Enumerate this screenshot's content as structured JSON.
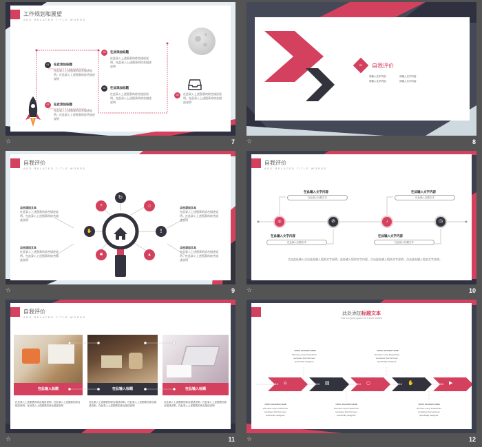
{
  "common": {
    "star": "☆",
    "sub": "ADD RELATED TITLE WORDS",
    "heading": "自我评价"
  },
  "s7": {
    "num": "7",
    "title": "工作规划和展望",
    "items": [
      {
        "no": "01",
        "head": "在此添加标题",
        "body": "在此录入上述图表的综合描述说明，在此录入上述图表的综合描述说明"
      },
      {
        "no": "02",
        "head": "在此添加标题",
        "body": "在此录入上述图表的综合描述说明，在此录入上述图表的综合描述说明"
      },
      {
        "no": "03",
        "head": "在此添加标题",
        "body": "在此录入上述图表的综合描述说明，在此录入上述图表的综合描述说明"
      },
      {
        "no": "04",
        "head": "在此添加标题",
        "body": "在此录入上述图表的综合描述说明，在此录入上述图表的综合描述说明"
      },
      {
        "no": "05",
        "body": "在此录入上述图表的综合描述说明，在此录入上述图表的综合描述说明"
      }
    ]
  },
  "s8": {
    "num": "8",
    "no": "02",
    "title": "自我评价",
    "lines": [
      "请输入文字内容",
      "请输入文字内容",
      "请输入文字内容",
      "请输入文字内容"
    ]
  },
  "s9": {
    "num": "9",
    "labels": [
      {
        "head": "点击添加文本",
        "body": "在此录入上述图表的综合描述说明，在此录入上述图表的综合描述说明"
      },
      {
        "head": "点击添加文本",
        "body": "在此录入上述图表的综合描述说明，在此录入上述图表的综合描述说明"
      },
      {
        "head": "点击添加文本",
        "body": "在此录入上述图表的综合描述说明，在此录入上述图表的综合描述说明"
      },
      {
        "head": "点击添加文本",
        "body": "在此录入上述图表的综合描述说明，在此录入上述图表的综合描述说明"
      }
    ]
  },
  "s10": {
    "num": "10",
    "head": "在此输入文字内容",
    "pill": "在此输入标题文本",
    "footer": "点击此处输入点击此处输入相关文字说明，此处输入您的文字内容，点击此处输入相关文字说明，点击此处输入相关文字说明。"
  },
  "s11": {
    "num": "11",
    "cap": "在此输入标题",
    "desc": "在此录入上述图表的综合描述说明，在此录入上述图表的综合描述说明，在此录入上述图表的综合描述说明"
  },
  "s12": {
    "num": "12",
    "title_a": "此处添加",
    "title_b": "标题文本",
    "sub": "This is a good space for a short subline",
    "years": [
      "2012",
      "2013",
      "2014",
      "2015",
      "2016"
    ],
    "topic": "TOPIC HEADER HERE",
    "body": [
      "We have many PowerPoint",
      "templates that has been",
      "specifically designed."
    ]
  },
  "colors": {
    "accent": "#d4415e",
    "dark": "#33333d",
    "bg": "#545454"
  }
}
